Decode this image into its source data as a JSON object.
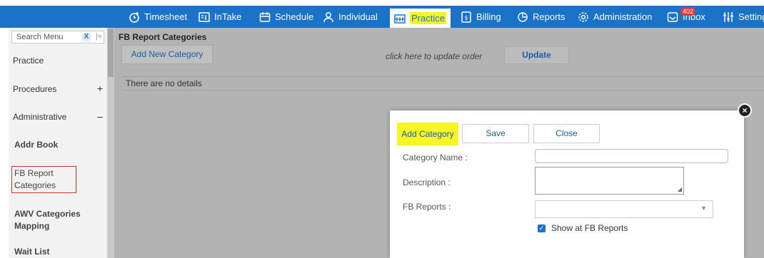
{
  "nav": {
    "items": [
      {
        "label": "Timesheet",
        "icon": "timesheet-icon"
      },
      {
        "label": "InTake",
        "icon": "intake-icon"
      },
      {
        "label": "Schedule",
        "icon": "calendar-icon"
      },
      {
        "label": "Individual",
        "icon": "person-icon"
      },
      {
        "label": "Practice",
        "icon": "practice-icon",
        "active": true
      },
      {
        "label": "Billing",
        "icon": "billing-icon"
      },
      {
        "label": "Reports",
        "icon": "pie-chart-icon"
      },
      {
        "label": "Administration",
        "icon": "gear-icon"
      },
      {
        "label": "Inbox",
        "icon": "inbox-icon",
        "badge": "402"
      },
      {
        "label": "Setting",
        "icon": "sliders-icon"
      }
    ]
  },
  "sidebar": {
    "search_placeholder": "Search Menu",
    "clear_label": "X",
    "pin_glyph": "|«",
    "items": [
      {
        "label": "Practice"
      },
      {
        "label": "Procedures",
        "sign": "+"
      },
      {
        "label": "Administrative",
        "sign": "–"
      },
      {
        "label": "Addr Book"
      },
      {
        "label": "FB Report Categories",
        "line1": "FB Report",
        "line2": "Categories"
      },
      {
        "label": "AWV Categories Mapping",
        "line1": "AWV Categories",
        "line2": "Mapping"
      },
      {
        "label": "Wait List"
      }
    ]
  },
  "main": {
    "title": "FB Report Categories",
    "add_new_label": "Add New Category",
    "order_hint": "click here to update order",
    "update_label": "Update",
    "empty_text": "There are no details"
  },
  "modal": {
    "title": "Add Category",
    "save_label": "Save",
    "close_label": "Close",
    "close_glyph": "×",
    "category_name_label": "Category Name :",
    "category_name_value": "",
    "description_label": "Description :",
    "description_value": "",
    "fb_reports_label": "FB Reports :",
    "fb_reports_value": "",
    "show_checkbox_label": "Show at FB Reports",
    "show_checked": true
  },
  "colors": {
    "nav_bg": "#1a73c9",
    "highlight": "#f7f428",
    "link_blue": "#1a5fa8",
    "badge_red": "#e53935"
  }
}
